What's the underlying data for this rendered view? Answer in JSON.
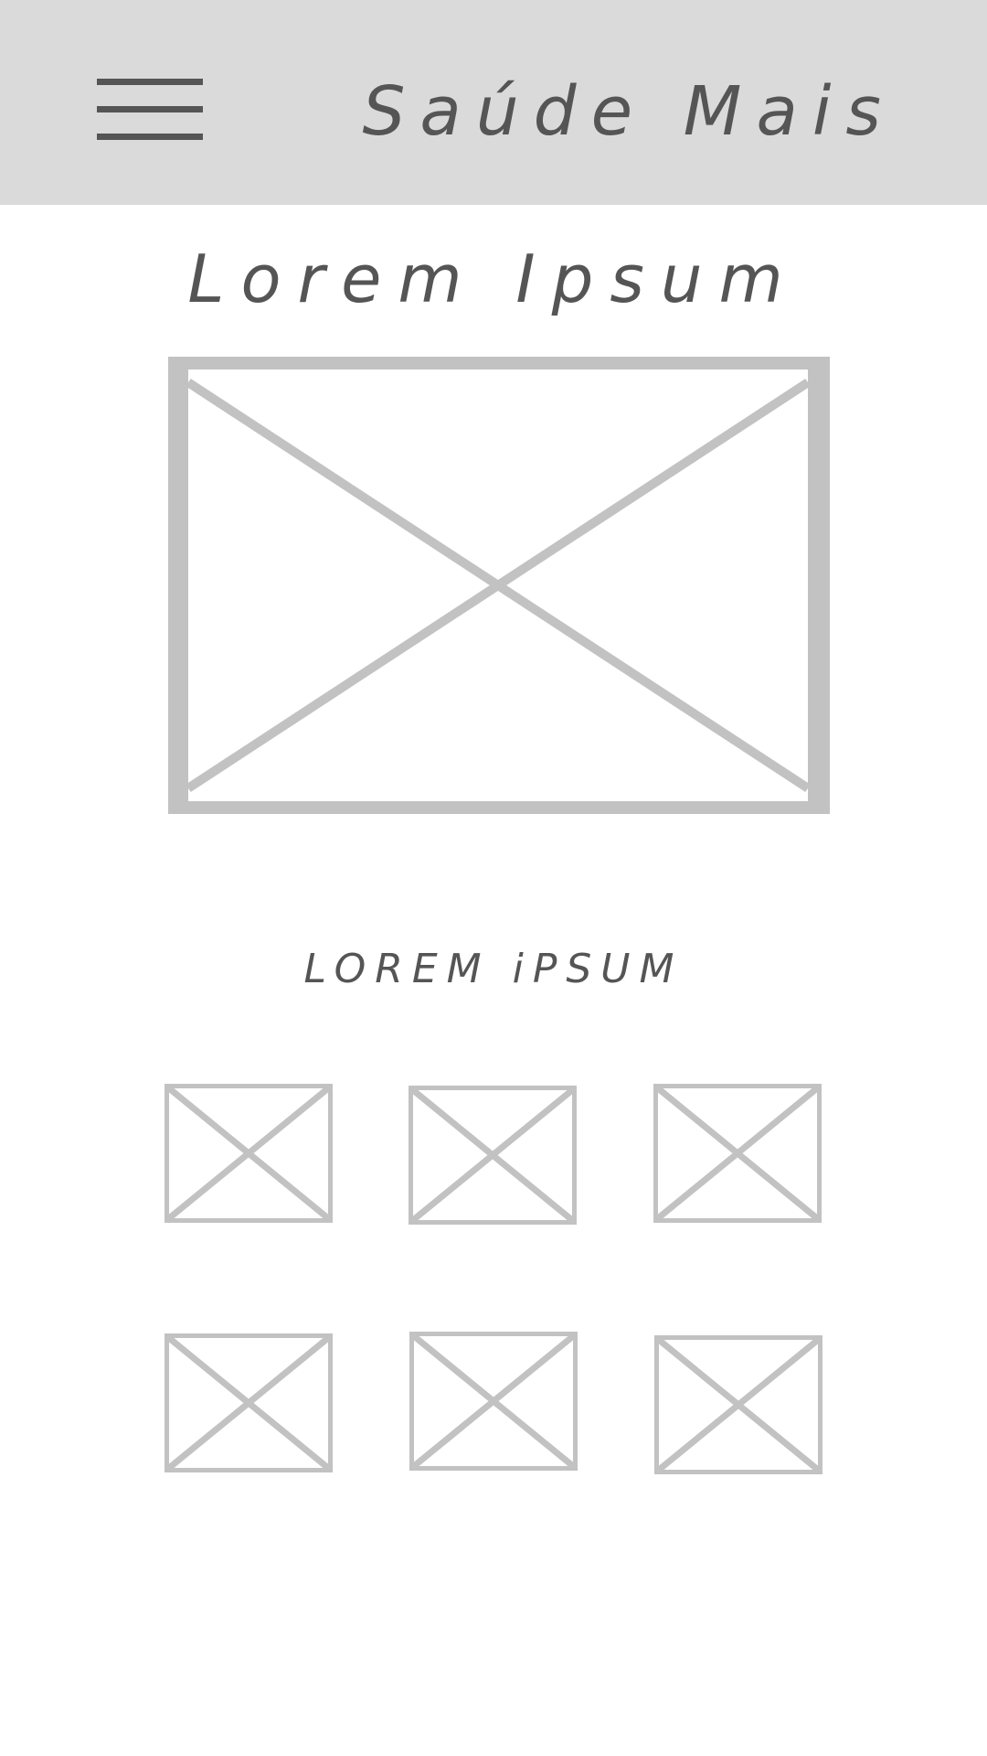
{
  "header": {
    "app_title": "Saúde Mais",
    "menu_icon": "hamburger-menu-icon",
    "background_color": "#dadada"
  },
  "main": {
    "title": "Lorem Ipsum",
    "hero_image_icon": "image-placeholder-icon",
    "section_title": "LOREM iPSUM",
    "thumbnails": [
      {
        "icon": "image-placeholder-icon"
      },
      {
        "icon": "image-placeholder-icon"
      },
      {
        "icon": "image-placeholder-icon"
      },
      {
        "icon": "image-placeholder-icon"
      },
      {
        "icon": "image-placeholder-icon"
      },
      {
        "icon": "image-placeholder-icon"
      }
    ]
  },
  "colors": {
    "text": "#555555",
    "placeholder_stroke": "#c2c2c2",
    "background": "#ffffff"
  }
}
